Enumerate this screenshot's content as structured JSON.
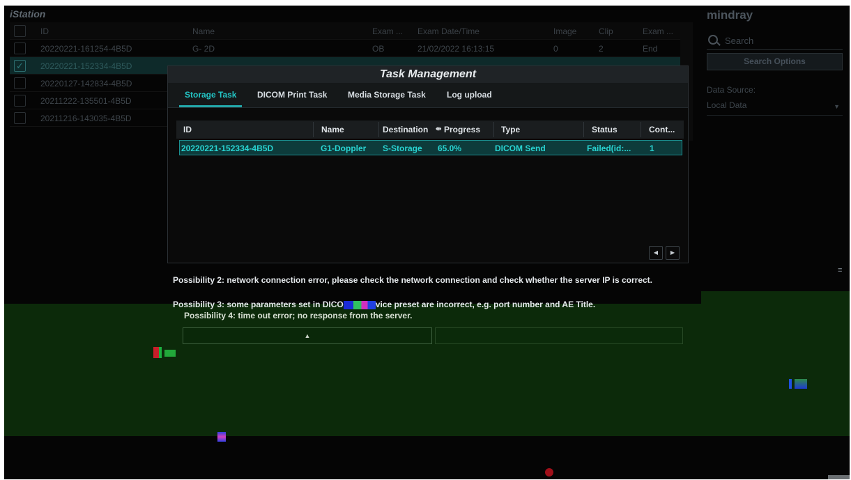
{
  "app": {
    "title": "iStation",
    "brand": "mindray"
  },
  "exam_list": {
    "columns": {
      "id": "ID",
      "name": "Name",
      "exam": "Exam ...",
      "date": "Exam Date/Time",
      "image": "Image",
      "clip": "Clip",
      "exam2": "Exam ..."
    },
    "rows": [
      {
        "id": "20220221-161254-4B5D",
        "name": "G- 2D",
        "exam": "OB",
        "date": "21/02/2022 16:13:15",
        "image": "0",
        "clip": "2",
        "exam2": "End",
        "checked": false
      },
      {
        "id": "20220221-152334-4B5D",
        "name": "",
        "exam": "",
        "date": "",
        "image": "",
        "clip": "",
        "exam2": "",
        "checked": true
      },
      {
        "id": "20220127-142834-4B5D",
        "name": "",
        "exam": "",
        "date": "",
        "image": "",
        "clip": "",
        "exam2": "",
        "checked": false
      },
      {
        "id": "20211222-135501-4B5D",
        "name": "",
        "exam": "",
        "date": "",
        "image": "",
        "clip": "",
        "exam2": "",
        "checked": false
      },
      {
        "id": "20211216-143035-4B5D",
        "name": "",
        "exam": "",
        "date": "",
        "image": "",
        "clip": "",
        "exam2": "",
        "checked": false
      }
    ]
  },
  "right_panel": {
    "search_placeholder": "Search",
    "search_options": "Search Options",
    "data_source_label": "Data Source:",
    "data_source_value": "Local Data"
  },
  "dialog": {
    "title": "Task Management",
    "tabs": [
      "Storage Task",
      "DICOM Print Task",
      "Media Storage Task",
      "Log upload"
    ],
    "columns": {
      "id": "ID",
      "name": "Name",
      "destination": "Destination",
      "progress": "Progress",
      "type": "Type",
      "status": "Status",
      "cont": "Cont..."
    },
    "rows": [
      {
        "id": "20220221-152334-4B5D",
        "name": "G1-Doppler",
        "destination": "S-Storage",
        "progress": "65.0%",
        "type": "DICOM Send",
        "status": "Failed(id:...",
        "cont": "1"
      }
    ],
    "messages": {
      "p2": "Possibility 2: network connection error, please check the network connection and check whether the server IP is correct.",
      "p3_start": "Possibility 3: some parameters set in DICO",
      "p3_end": "vice preset are incorrect, e.g. port number and AE Title.",
      "p4": "Possibility 4: time out error; no response from the server."
    }
  }
}
